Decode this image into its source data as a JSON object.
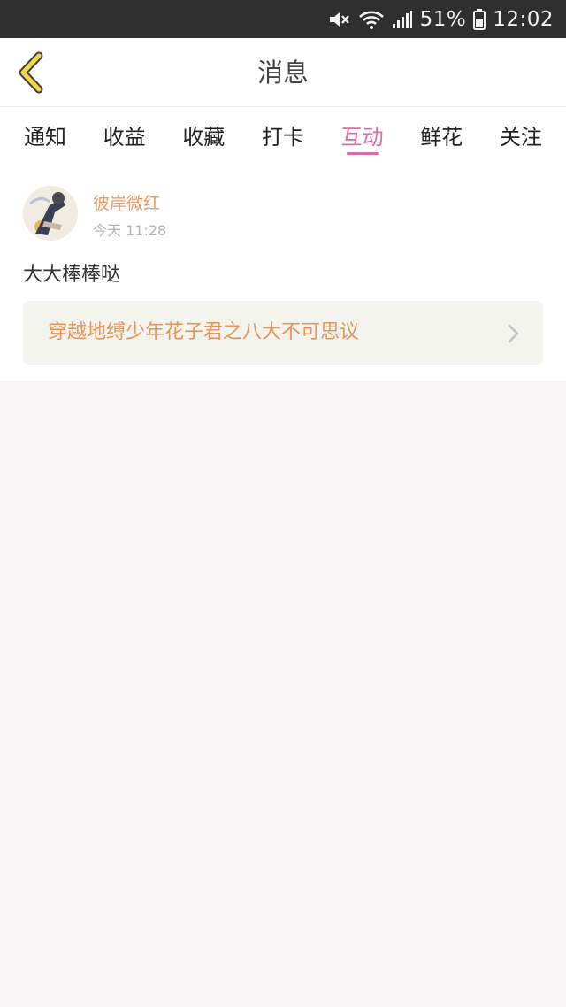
{
  "status_bar": {
    "battery": "51%",
    "time": "12:02",
    "icons": [
      "mute-icon",
      "wifi-icon",
      "signal-icon",
      "battery-icon"
    ]
  },
  "header": {
    "title": "消息",
    "back_icon": "back-chevron-icon"
  },
  "tabs": [
    {
      "label": "通知",
      "active": false
    },
    {
      "label": "收益",
      "active": false
    },
    {
      "label": "收藏",
      "active": false
    },
    {
      "label": "打卡",
      "active": false
    },
    {
      "label": "互动",
      "active": true
    },
    {
      "label": "鲜花",
      "active": false
    },
    {
      "label": "关注",
      "active": false
    }
  ],
  "message": {
    "username": "彼岸微红",
    "time": "今天 11:28",
    "text": "大大棒棒哒",
    "reference_title": "穿越地缚少年花子君之八大不可思议",
    "reference_icon": "chevron-right-icon"
  },
  "colors": {
    "accent": "#e06aa3",
    "username": "#e89a64",
    "reference_text": "#e8935a",
    "back_icon": "#f3d648"
  }
}
